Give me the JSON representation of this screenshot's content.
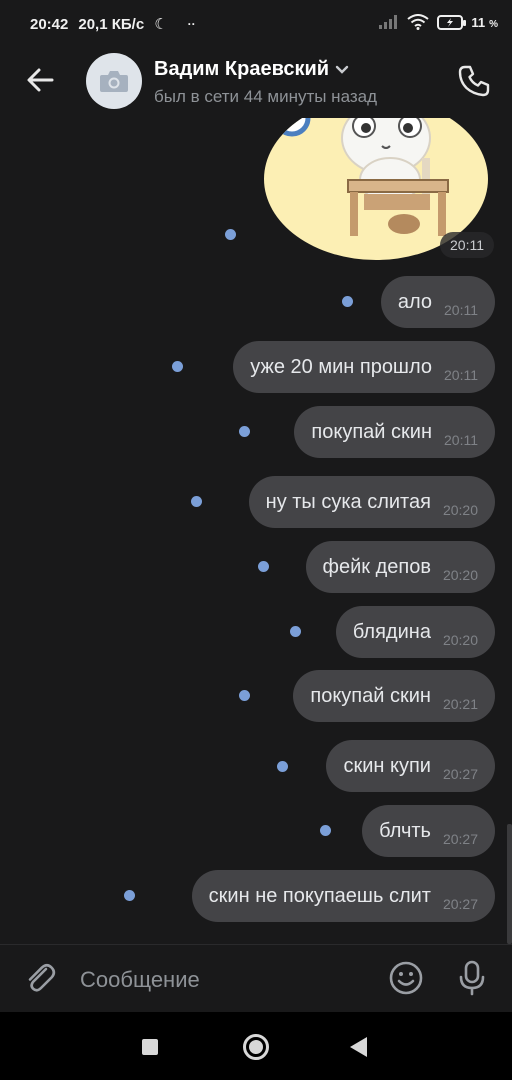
{
  "status_bar": {
    "time": "20:42",
    "net_speed": "20,1 КБ/с",
    "battery_level": "11",
    "battery_unit": "%"
  },
  "header": {
    "contact_name": "Вадим Краевский",
    "last_seen": "был в сети 44 минуты назад"
  },
  "sticker": {
    "time": "20:11"
  },
  "messages": [
    {
      "text": "ало",
      "time": "20:11"
    },
    {
      "text": "уже 20 мин прошло",
      "time": "20:11"
    },
    {
      "text": "покупай скин",
      "time": "20:11"
    },
    {
      "text": "ну ты сука слитая",
      "time": "20:20"
    },
    {
      "text": "фейк депов",
      "time": "20:20"
    },
    {
      "text": "блядина",
      "time": "20:20"
    },
    {
      "text": "покупай скин",
      "time": "20:21"
    },
    {
      "text": "скин купи",
      "time": "20:27"
    },
    {
      "text": "блчть",
      "time": "20:27"
    },
    {
      "text": "скин не покупаешь слит",
      "time": "20:27"
    }
  ],
  "composer": {
    "placeholder": "Сообщение"
  },
  "colors": {
    "background": "#19191a",
    "bubble": "#444447",
    "unread_dot": "#7b9fd8"
  },
  "icons": {
    "back": "arrow-left-icon",
    "avatar": "camera-icon",
    "dropdown": "chevron-down-icon",
    "call": "phone-icon",
    "attach": "paperclip-icon",
    "emoji": "smiley-icon",
    "mic": "microphone-icon"
  }
}
